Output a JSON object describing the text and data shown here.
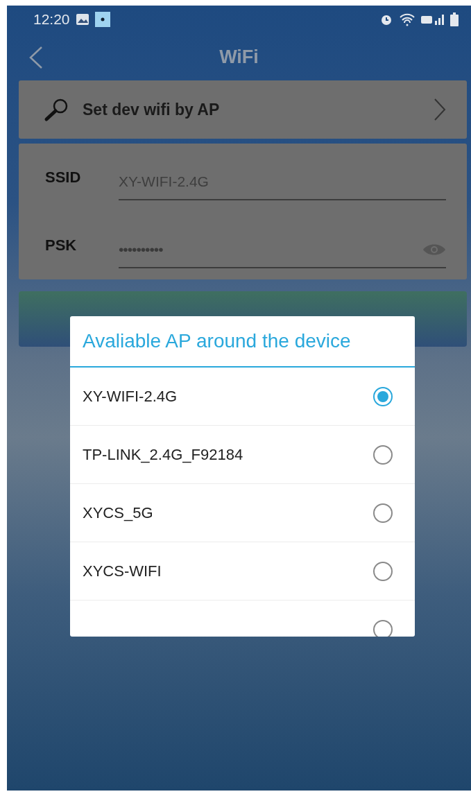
{
  "status_bar": {
    "time": "12:20"
  },
  "nav": {
    "title": "WiFi"
  },
  "ap_setting": {
    "label": "Set dev wifi by AP"
  },
  "form": {
    "fields": [
      {
        "kind": "text",
        "label": "SSID",
        "value": "XY-WIFI-2.4G"
      },
      {
        "kind": "password",
        "label": "PSK",
        "value": "••••••••••"
      }
    ]
  },
  "dialog": {
    "title": "Avaliable AP around the device",
    "items": [
      {
        "name": "XY-WIFI-2.4G",
        "selected": true
      },
      {
        "name": "TP-LINK_2.4G_F92184",
        "selected": false
      },
      {
        "name": "XYCS_5G",
        "selected": false
      },
      {
        "name": "XYCS-WIFI",
        "selected": false
      },
      {
        "selected": false
      }
    ]
  }
}
